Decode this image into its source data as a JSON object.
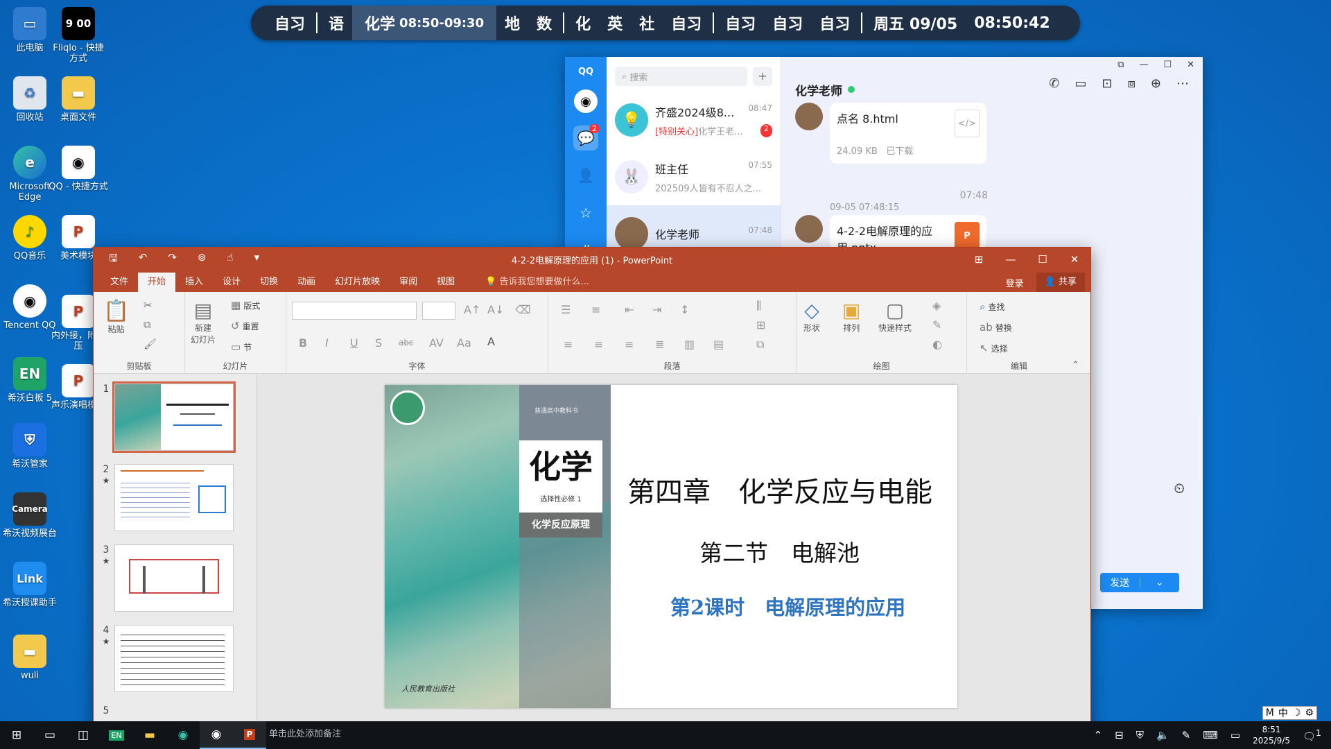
{
  "desktop": {
    "icons": [
      {
        "label": "此电脑",
        "icon": "computer-icon"
      },
      {
        "label": "Fliqlo - 快捷方式",
        "icon": "clock-icon",
        "glyph": "9 00"
      },
      {
        "label": "回收站",
        "icon": "recycle-bin-icon"
      },
      {
        "label": "桌面文件",
        "icon": "folder-icon"
      },
      {
        "label": "Microsoft Edge",
        "icon": "edge-icon"
      },
      {
        "label": "QQ - 快捷方式",
        "icon": "qq-icon"
      },
      {
        "label": "QQ音乐",
        "icon": "qq-music-icon"
      },
      {
        "label": "美术模块",
        "icon": "pptx-file-icon"
      },
      {
        "label": "Tencent QQ",
        "icon": "qq-icon"
      },
      {
        "label": "内外接，附分压",
        "icon": "pptx-file-icon"
      },
      {
        "label": "希沃白板 5",
        "icon": "seewo-board-icon",
        "glyph": "EN"
      },
      {
        "label": "声乐演唱模课",
        "icon": "pptx-file-icon"
      },
      {
        "label": "希沃管家",
        "icon": "seewo-guard-icon"
      },
      {
        "label": "希沃视频展台",
        "icon": "camera-icon",
        "glyph": "Camera"
      },
      {
        "label": "希沃授课助手",
        "icon": "link-icon",
        "glyph": "Link"
      },
      {
        "label": "wuli",
        "icon": "folder-icon"
      }
    ]
  },
  "schedule": {
    "items": [
      "自习",
      "语",
      "化学",
      "地",
      "数",
      "化",
      "英",
      "社",
      "自习",
      "自习",
      "自习",
      "自习"
    ],
    "current_time": "08:50-09:30",
    "date": "周五 09/05",
    "clock": "08:50:42"
  },
  "qq": {
    "logo": "QQ",
    "search_placeholder": "搜索",
    "nav_badge": "2",
    "conversations": [
      {
        "name": "齐盛2024级8...",
        "time": "08:47",
        "preview_tag": "[特别关心]",
        "preview": "化学王老...",
        "unread": "2"
      },
      {
        "name": "班主任",
        "time": "07:55",
        "preview": "202509人皆有不忍人之..."
      },
      {
        "name": "化学老师",
        "time": "07:48",
        "preview": ""
      }
    ],
    "chat": {
      "title": "化学老师",
      "messages": [
        {
          "file": "点名 8.html",
          "size": "24.09 KB",
          "status": "已下载",
          "file_icon": "code-file-icon"
        },
        {
          "file": "4-2-2电解原理的应用.pptx",
          "file_icon": "pptx-file-icon"
        }
      ],
      "timestamp1": "07:48",
      "timestamp2": "09-05 07:48:15",
      "send_label": "发送"
    }
  },
  "ppt": {
    "title": "4-2-2电解原理的应用 (1) - PowerPoint",
    "tabs": [
      "文件",
      "开始",
      "插入",
      "设计",
      "切换",
      "动画",
      "幻灯片放映",
      "审阅",
      "视图"
    ],
    "active_tab": "开始",
    "tell_me": "告诉我您想要做什么...",
    "login": "登录",
    "share": "共享",
    "ribbon": {
      "clipboard": {
        "label": "剪贴板",
        "paste": "粘贴"
      },
      "slides": {
        "label": "幻灯片",
        "new_slide": "新建\n幻灯片",
        "layout": "版式",
        "reset": "重置",
        "section": "节"
      },
      "font": {
        "label": "字体"
      },
      "paragraph": {
        "label": "段落"
      },
      "drawing": {
        "label": "绘图",
        "shapes": "形状",
        "arrange": "排列",
        "quick_styles": "快速样式"
      },
      "editing": {
        "label": "编辑",
        "find": "查找",
        "replace": "替换",
        "select": "选择"
      }
    },
    "thumb_numbers": [
      "1",
      "2",
      "3",
      "4",
      "5"
    ],
    "slide": {
      "title": "第四章　化学反应与电能",
      "subtitle": "第二节　电解池",
      "lesson": "第2课时　电解原理的应用",
      "cover_big": "化学",
      "cover_small": "选择性必修 1",
      "cover_sub": "化学反应原理",
      "cover_top": "普通高中教科书",
      "publisher": "人民教育出版社"
    },
    "notes_placeholder": "单击此处添加备注"
  },
  "taskbar": {
    "time": "8:51",
    "date": "2025/9/5",
    "notification_count": "1",
    "ime": "中"
  }
}
